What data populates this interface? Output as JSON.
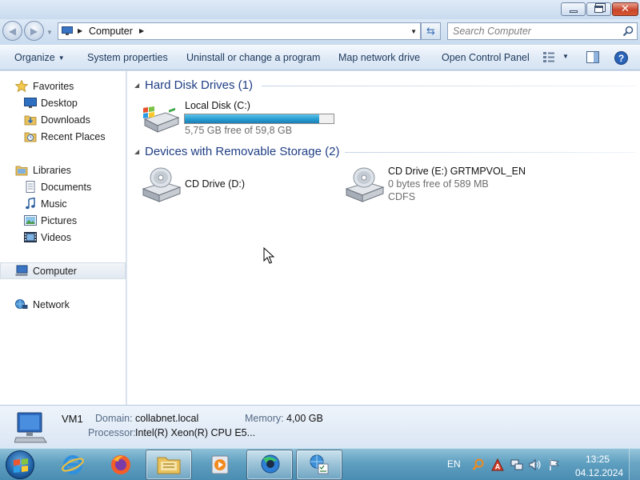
{
  "window": {
    "controls": {
      "minimize_icon": "minimize-icon",
      "maximize_icon": "maximize-icon",
      "close_icon": "close-icon"
    }
  },
  "address_bar": {
    "breadcrumbs": [
      "Computer"
    ],
    "search_placeholder": "Search Computer"
  },
  "toolbar": {
    "organize": "Organize",
    "system_properties": "System properties",
    "uninstall": "Uninstall or change a program",
    "map_network_drive": "Map network drive",
    "open_control_panel": "Open Control Panel"
  },
  "sidebar": {
    "favorites": {
      "label": "Favorites",
      "items": [
        {
          "label": "Desktop"
        },
        {
          "label": "Downloads"
        },
        {
          "label": "Recent Places"
        }
      ]
    },
    "libraries": {
      "label": "Libraries",
      "items": [
        {
          "label": "Documents"
        },
        {
          "label": "Music"
        },
        {
          "label": "Pictures"
        },
        {
          "label": "Videos"
        }
      ]
    },
    "computer": {
      "label": "Computer",
      "selected": true
    },
    "network": {
      "label": "Network"
    }
  },
  "groups": [
    {
      "title": "Hard Disk Drives (1)",
      "drives": [
        {
          "name": "Local Disk (C:)",
          "free_text": "5,75 GB free of 59,8 GB",
          "used_fraction": 0.904,
          "bar_color": "#2b9fd3"
        }
      ]
    },
    {
      "title": "Devices with Removable Storage (2)",
      "drives": [
        {
          "name": "CD Drive (D:)"
        },
        {
          "name": "CD Drive (E:) GRTMPVOL_EN",
          "free_text": "0 bytes free of 589 MB",
          "filesystem": "CDFS"
        }
      ]
    }
  ],
  "details": {
    "name": "VM1",
    "domain_label": "Domain:",
    "domain_value": "collabnet.local",
    "memory_label": "Memory:",
    "memory_value": "4,00 GB",
    "processor_label": "Processor:",
    "processor_value": "Intel(R) Xeon(R) CPU E5..."
  },
  "taskbar": {
    "buttons": [
      {
        "icon": "internet-explorer-icon"
      },
      {
        "icon": "firefox-icon"
      },
      {
        "icon": "windows-explorer-icon",
        "active": true
      },
      {
        "icon": "media-player-icon"
      },
      {
        "icon": "app-icon"
      },
      {
        "icon": "network-settings-icon"
      }
    ],
    "language": "EN",
    "time": "13:25",
    "date": "04.12.2024"
  }
}
